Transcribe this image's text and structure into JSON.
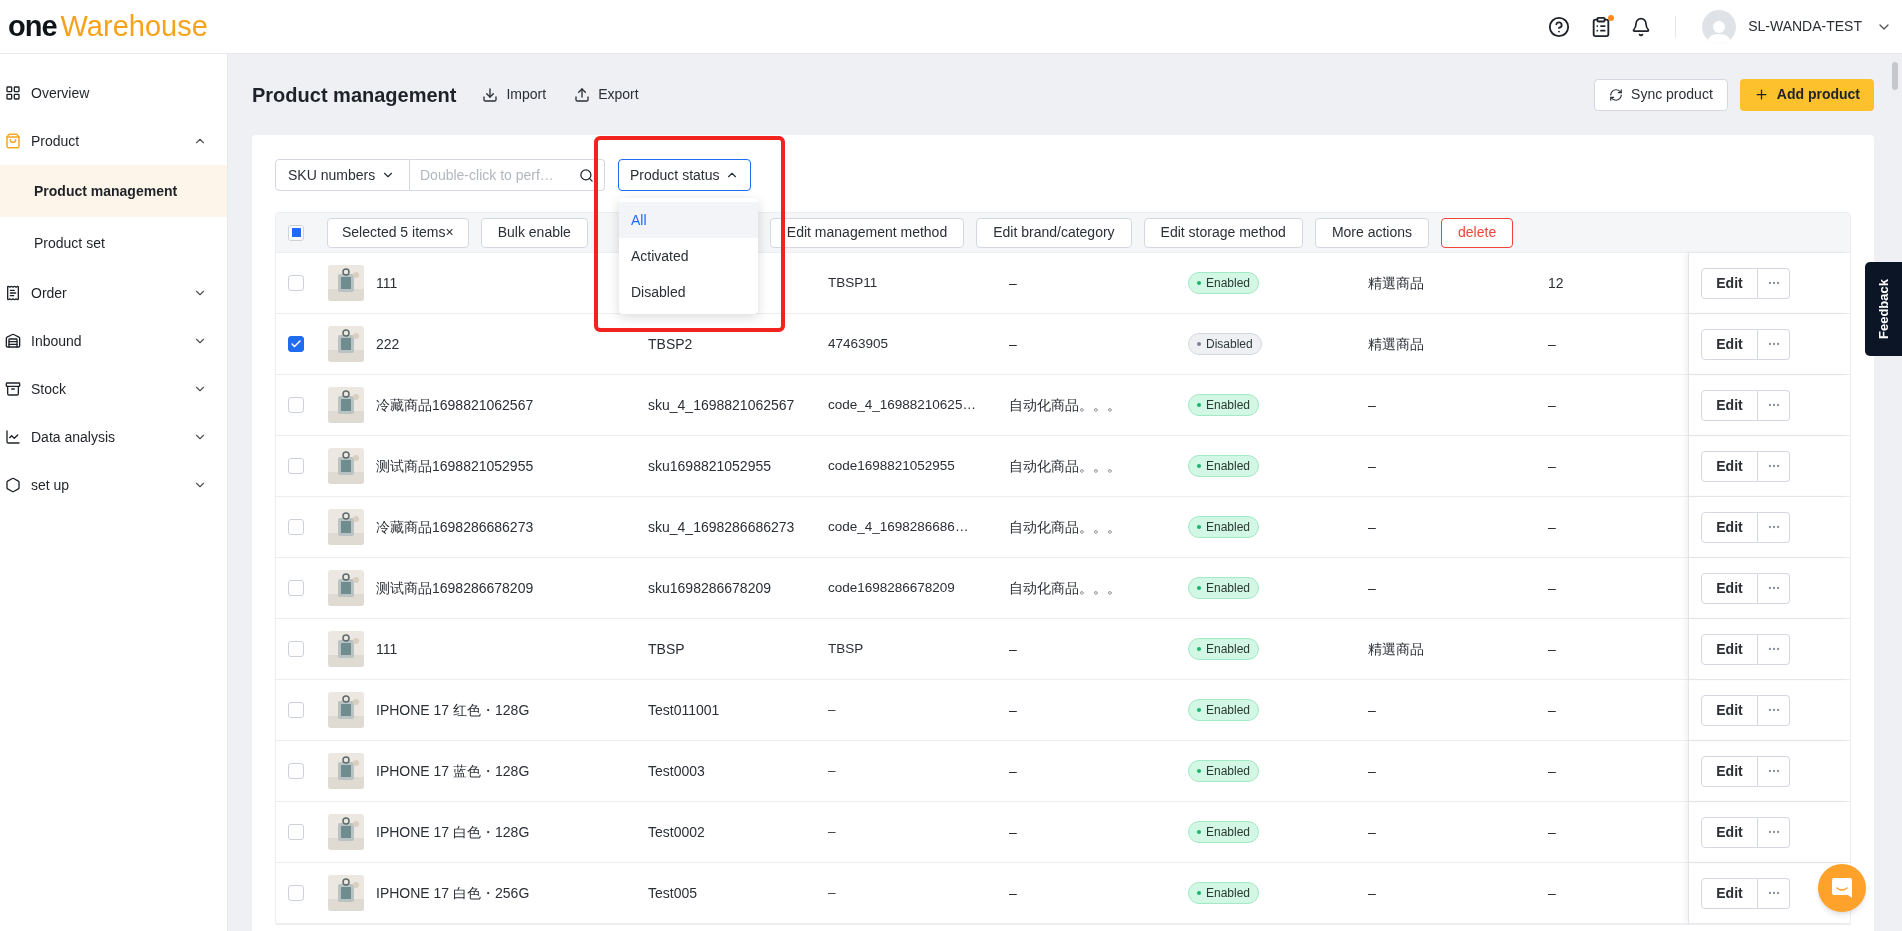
{
  "header": {
    "logo": {
      "part_1": "one",
      "part_2": "Warehouse"
    },
    "notification_badge": true,
    "user": "SL-WANDA-TEST"
  },
  "sidebar": {
    "items": [
      {
        "label": "Overview",
        "kind": "link",
        "selected": false
      },
      {
        "label": "Product",
        "kind": "group",
        "selected": true,
        "expanded": true,
        "children": [
          {
            "label": "Product management",
            "selected": true
          },
          {
            "label": "Product set",
            "selected": false
          }
        ]
      },
      {
        "label": "Order",
        "kind": "group",
        "selected": false,
        "expanded": false
      },
      {
        "label": "Inbound",
        "kind": "group",
        "selected": false,
        "expanded": false
      },
      {
        "label": "Stock",
        "kind": "group",
        "selected": false,
        "expanded": false
      },
      {
        "label": "Data analysis",
        "kind": "group",
        "selected": false,
        "expanded": false
      },
      {
        "label": "set up",
        "kind": "group",
        "selected": false,
        "expanded": false
      }
    ]
  },
  "page": {
    "title": "Product management",
    "actions": [
      {
        "label": "Import",
        "kind": "import"
      },
      {
        "label": "Export",
        "kind": "export"
      }
    ],
    "buttons": [
      {
        "label": "Sync product",
        "kind": "secondary"
      },
      {
        "label": "Add product",
        "kind": "primary"
      }
    ]
  },
  "filters": {
    "field_select": "SKU numbers",
    "search": {
      "placeholder": "Double-click to perf…"
    },
    "status_filter": {
      "label": "Product status",
      "expanded": true,
      "options": [
        {
          "label": "All",
          "selected": true
        },
        {
          "label": "Activated",
          "selected": false
        },
        {
          "label": "Disabled",
          "selected": false
        }
      ]
    }
  },
  "bulk_bar": {
    "select_all_indeterminate": true,
    "selection": {
      "label": "Selected 5 items",
      "clear": "×"
    },
    "actions": [
      {
        "label": "Bulk enable",
        "kind": "default"
      },
      {
        "label": "Edit management method",
        "kind": "default"
      },
      {
        "label": "Edit brand/category",
        "kind": "default"
      },
      {
        "label": "Edit storage method",
        "kind": "default"
      },
      {
        "label": "More actions",
        "kind": "default"
      },
      {
        "label": "delete",
        "kind": "danger"
      }
    ]
  },
  "rows": [
    {
      "checked": false,
      "name": "111",
      "code": "TBSP11",
      "column_4": "–",
      "status": {
        "label": "Enabled",
        "kind": "enabled"
      },
      "column_6": "精選商品",
      "column_7": "12",
      "edit": "Edit"
    },
    {
      "checked": true,
      "name": "222",
      "sku": "TBSP2",
      "code": "47463905",
      "column_4": "–",
      "status": {
        "label": "Disabled",
        "kind": "disabled"
      },
      "column_6": "精選商品",
      "column_7": "–",
      "edit": "Edit"
    },
    {
      "checked": false,
      "name": "冷藏商品1698821062567",
      "sku": "sku_4_1698821062567",
      "code": "code_4_16988210625…",
      "column_4": "自动化商品。。。",
      "status": {
        "label": "Enabled",
        "kind": "enabled"
      },
      "column_6": "–",
      "column_7": "–",
      "edit": "Edit"
    },
    {
      "checked": false,
      "name": "测试商品1698821052955",
      "sku": "sku1698821052955",
      "code": "code1698821052955",
      "column_4": "自动化商品。。。",
      "status": {
        "label": "Enabled",
        "kind": "enabled"
      },
      "column_6": "–",
      "column_7": "–",
      "edit": "Edit"
    },
    {
      "checked": false,
      "name": "冷藏商品1698286686273",
      "sku": "sku_4_1698286686273",
      "code": "code_4_1698286686…",
      "column_4": "自动化商品。。。",
      "status": {
        "label": "Enabled",
        "kind": "enabled"
      },
      "column_6": "–",
      "column_7": "–",
      "edit": "Edit"
    },
    {
      "checked": false,
      "name": "测试商品1698286678209",
      "sku": "sku1698286678209",
      "code": "code1698286678209",
      "column_4": "自动化商品。。。",
      "status": {
        "label": "Enabled",
        "kind": "enabled"
      },
      "column_6": "–",
      "column_7": "–",
      "edit": "Edit"
    },
    {
      "checked": false,
      "name": "111",
      "sku": "TBSP",
      "code": "TBSP",
      "column_4": "–",
      "status": {
        "label": "Enabled",
        "kind": "enabled"
      },
      "column_6": "精選商品",
      "column_7": "–",
      "edit": "Edit"
    },
    {
      "checked": false,
      "name": "IPHONE 17 红色・128G",
      "sku": "Test011001",
      "code": "–",
      "column_4": "–",
      "status": {
        "label": "Enabled",
        "kind": "enabled"
      },
      "column_6": "–",
      "column_7": "–",
      "edit": "Edit"
    },
    {
      "checked": false,
      "name": "IPHONE 17 蓝色・128G",
      "sku": "Test0003",
      "code": "–",
      "column_4": "–",
      "status": {
        "label": "Enabled",
        "kind": "enabled"
      },
      "column_6": "–",
      "column_7": "–",
      "edit": "Edit"
    },
    {
      "checked": false,
      "name": "IPHONE 17 白色・128G",
      "sku": "Test0002",
      "code": "–",
      "column_4": "–",
      "status": {
        "label": "Enabled",
        "kind": "enabled"
      },
      "column_6": "–",
      "column_7": "–",
      "edit": "Edit"
    },
    {
      "checked": false,
      "name": "IPHONE 17 白色・256G",
      "sku": "Test005",
      "code": "–",
      "column_4": "–",
      "status": {
        "label": "Enabled",
        "kind": "enabled"
      },
      "column_6": "–",
      "column_7": "–",
      "edit": "Edit"
    }
  ],
  "feedback": "Feedback"
}
